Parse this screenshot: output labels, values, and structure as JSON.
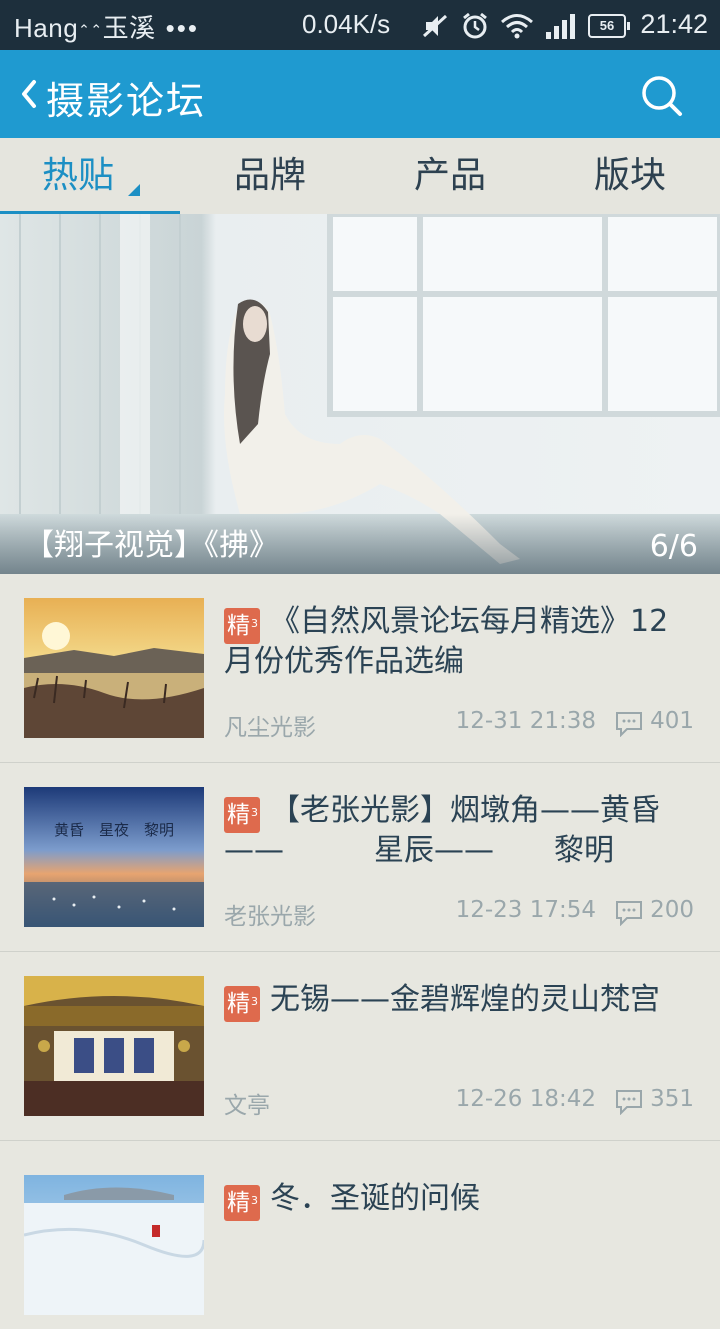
{
  "status_bar": {
    "carrier": "Hang()玉溪",
    "carrier_display": "Hang",
    "carrier_city": "玉溪",
    "dots": "•••",
    "speed": "0.04K/s",
    "battery": "56",
    "time": "21:42"
  },
  "app_bar": {
    "title": "摄影论坛",
    "back_icon": "chevron-left-icon",
    "search_icon": "search-icon",
    "color": "#1f9ad0"
  },
  "tabs": [
    {
      "label": "热贴",
      "active": true
    },
    {
      "label": "品牌",
      "active": false
    },
    {
      "label": "产品",
      "active": false
    },
    {
      "label": "版块",
      "active": false
    }
  ],
  "banner": {
    "title": "【翔子视觉】《拂》",
    "counter": "6/6"
  },
  "posts": [
    {
      "badge": "精",
      "badge_sub": "3",
      "title": "《自然风景论坛每月精选》12月份优秀作品选编",
      "author": "凡尘光影",
      "date": "12-31 21:38",
      "comments": "401"
    },
    {
      "badge": "精",
      "badge_sub": "3",
      "title": "【老张光影】烟墩角——黄昏——　　　星辰——　　黎明",
      "author": "老张光影",
      "date": "12-23 17:54",
      "comments": "200",
      "thumb_text": "黄昏　星夜　黎明"
    },
    {
      "badge": "精",
      "badge_sub": "3",
      "title": "无锡——金碧辉煌的灵山梵宫",
      "author": "文亭",
      "date": "12-26 18:42",
      "comments": "351"
    },
    {
      "badge": "精",
      "badge_sub": "3",
      "title": "冬．圣诞的问候",
      "author": "",
      "date": "",
      "comments": ""
    }
  ],
  "colors": {
    "accent": "#1c8fc4",
    "badge": "#de6a4d",
    "meta": "#9aa7ab",
    "title": "#2b4354"
  }
}
